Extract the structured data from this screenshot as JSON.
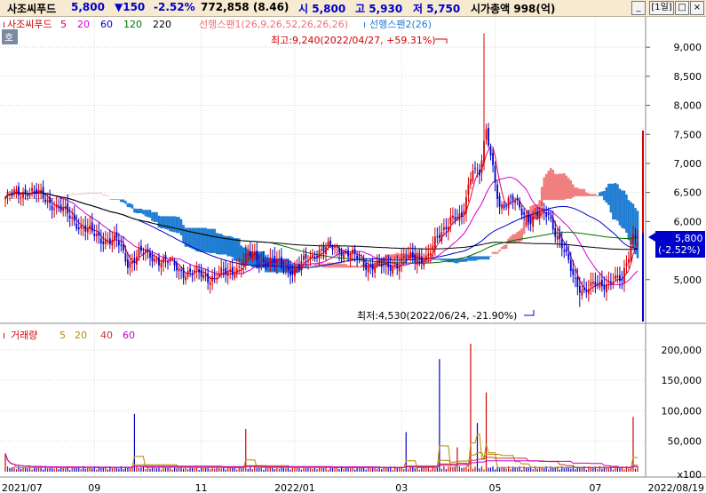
{
  "title_bar": {
    "stock_name": "사조씨푸드",
    "price": "5,800",
    "change": "▼150",
    "change_pct": "-2.52%",
    "volume_info": "772,858 (8.46)",
    "open": "시 5,800",
    "high": "고 5,930",
    "low": "저 5,750",
    "market_cap": "시가총액 998(억)",
    "period": "[1일]",
    "colors": {
      "down": "#0000cc",
      "up": "#d40000"
    }
  },
  "window_controls": [
    "_",
    "□",
    "×"
  ],
  "price_panel": {
    "corner_tab": "호",
    "legend": [
      {
        "text": "사조씨푸드",
        "color": "#d40000"
      },
      {
        "text": "5",
        "color": "#e0004a"
      },
      {
        "text": "20",
        "color": "#d400d4"
      },
      {
        "text": "60",
        "color": "#0000cc"
      },
      {
        "text": "120",
        "color": "#007000"
      },
      {
        "text": "220",
        "color": "#000000"
      },
      {
        "text": "선행스팬1(26,9,26,52,26,26,26)",
        "color": "#f07070"
      },
      {
        "text": "선행스팬2(26)",
        "color": "#1e7dd2"
      }
    ],
    "high_annotation": "최고:9,240(2022/04/27, +59.31%)",
    "low_annotation": "최저:4,530(2022/06/24, -21.90%)",
    "current_tag": [
      "5,800",
      "(-2.52%)"
    ],
    "y_ticks": [
      "9,000",
      "8,500",
      "8,000",
      "7,500",
      "7,000",
      "6,500",
      "6,000",
      "5,000"
    ]
  },
  "volume_panel": {
    "legend": [
      {
        "text": "거래량",
        "color": "#d40000"
      },
      {
        "text": "5",
        "color": "#b58a00"
      },
      {
        "text": "20",
        "color": "#b58a00"
      },
      {
        "text": "40",
        "color": "#c83232"
      },
      {
        "text": "60",
        "color": "#c800c8"
      }
    ],
    "y_ticks": [
      "200,000",
      "150,000",
      "100,000",
      "50,000",
      "x100"
    ]
  },
  "x_axis": {
    "labels": [
      "2021/07",
      "09",
      "11",
      "2022/01",
      "03",
      "05",
      "07",
      "2022/08/19"
    ]
  },
  "chart_data": {
    "type": "candlestick",
    "price_ymin": 4400,
    "price_ymax": 9400,
    "volume_ymax": 210000,
    "start": "2021/07",
    "end": "2022/08/19",
    "trading_days": 285,
    "closes_keypoints": [
      [
        0,
        6400
      ],
      [
        10,
        6550
      ],
      [
        20,
        6350
      ],
      [
        30,
        6050
      ],
      [
        40,
        5750
      ],
      [
        50,
        5650
      ],
      [
        55,
        5300
      ],
      [
        60,
        5450
      ],
      [
        70,
        5350
      ],
      [
        80,
        5150
      ],
      [
        90,
        5050
      ],
      [
        100,
        5100
      ],
      [
        110,
        5400
      ],
      [
        120,
        5300
      ],
      [
        130,
        5150
      ],
      [
        140,
        5500
      ],
      [
        150,
        5550
      ],
      [
        160,
        5300
      ],
      [
        170,
        5200
      ],
      [
        180,
        5350
      ],
      [
        190,
        5400
      ],
      [
        200,
        6100
      ],
      [
        205,
        6000
      ],
      [
        210,
        7000
      ],
      [
        213,
        6850
      ],
      [
        216,
        7500
      ],
      [
        219,
        6900
      ],
      [
        222,
        6300
      ],
      [
        228,
        6350
      ],
      [
        236,
        6050
      ],
      [
        244,
        6150
      ],
      [
        252,
        5350
      ],
      [
        256,
        5000
      ],
      [
        260,
        4800
      ],
      [
        266,
        4900
      ],
      [
        272,
        5000
      ],
      [
        277,
        4950
      ],
      [
        282,
        5800
      ],
      [
        285,
        5800
      ]
    ],
    "price_high": 9240,
    "price_low": 4530,
    "volume_spikes": [
      [
        0,
        30000
      ],
      [
        58,
        95000
      ],
      [
        108,
        70000
      ],
      [
        180,
        65000
      ],
      [
        195,
        185000
      ],
      [
        203,
        40000
      ],
      [
        209,
        210000
      ],
      [
        212,
        80000
      ],
      [
        216,
        130000
      ],
      [
        282,
        90000
      ]
    ],
    "moving_averages": [
      "5",
      "20",
      "60",
      "120",
      "220"
    ],
    "ichimoku": [
      "선행스팬1",
      "선행스팬2"
    ],
    "volume_ma": [
      "5",
      "20",
      "40",
      "60"
    ]
  }
}
